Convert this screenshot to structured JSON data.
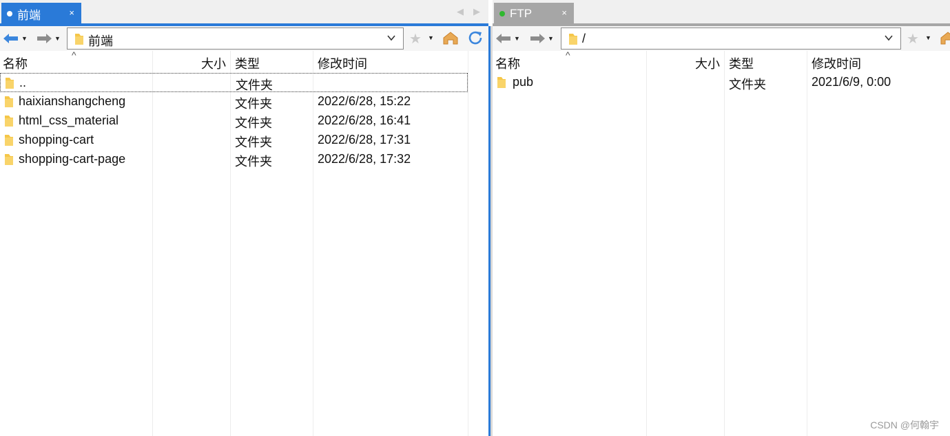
{
  "left_pane": {
    "tab": {
      "label": "前端",
      "close": "×"
    },
    "path": "前端",
    "columns": {
      "name": "名称",
      "size": "大小",
      "type": "类型",
      "modified": "修改时间"
    },
    "sort_indicator": "^",
    "rows": [
      {
        "name": "..",
        "size": "",
        "type": "文件夹",
        "modified": ""
      },
      {
        "name": "haixianshangcheng",
        "size": "",
        "type": "文件夹",
        "modified": "2022/6/28, 15:22"
      },
      {
        "name": "html_css_material",
        "size": "",
        "type": "文件夹",
        "modified": "2022/6/28, 16:41"
      },
      {
        "name": "shopping-cart",
        "size": "",
        "type": "文件夹",
        "modified": "2022/6/28, 17:31"
      },
      {
        "name": "shopping-cart-page",
        "size": "",
        "type": "文件夹",
        "modified": "2022/6/28, 17:32"
      }
    ]
  },
  "right_pane": {
    "tab": {
      "label": "FTP",
      "close": "×"
    },
    "path": "/",
    "columns": {
      "name": "名称",
      "size": "大小",
      "type": "类型",
      "modified": "修改时间"
    },
    "sort_indicator": "^",
    "rows": [
      {
        "name": "pub",
        "size": "",
        "type": "文件夹",
        "modified": "2021/6/9, 0:00"
      }
    ]
  },
  "tab_scroll": {
    "prev": "◀",
    "next": "▶"
  },
  "icons": {
    "back": "back-arrow-icon",
    "forward": "forward-arrow-icon",
    "folder": "folder-icon",
    "favorite": "star-icon",
    "home": "home-icon",
    "refresh": "refresh-icon"
  },
  "colors": {
    "accent": "#2a7ad8",
    "inactive_tab": "#a6a6a6",
    "connected_dot": "#2fb82f",
    "folder": "#f5c74a"
  },
  "watermark": "CSDN @何翰宇"
}
